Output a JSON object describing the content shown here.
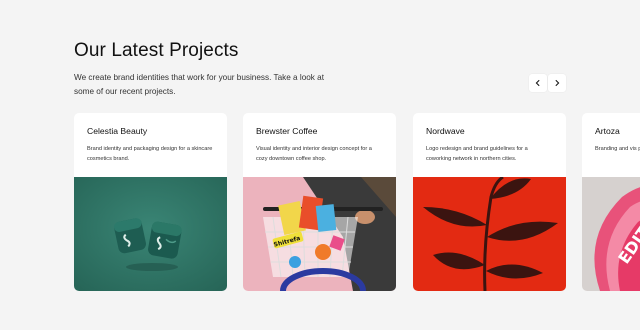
{
  "section": {
    "title": "Our Latest Projects",
    "subtitle": "We create brand identities that work for your business. Take a look at some of our recent projects."
  },
  "nav": {
    "prev_icon": "chevron-left-icon",
    "next_icon": "chevron-right-icon"
  },
  "projects": [
    {
      "name": "Celestia Beauty",
      "description": "Brand identity and packaging design for a skincare cosmetics brand.",
      "image": "skincare-jars-image",
      "image_bg": "#2f7466"
    },
    {
      "name": "Brewster Coffee",
      "description": "Visual identity and interior design concept for a cozy downtown coffee shop.",
      "image": "coffee-bike-basket-image",
      "image_bg": "#e9a8b4",
      "image_text": "Shitrefa"
    },
    {
      "name": "Nordwave",
      "description": "Logo redesign and brand guidelines for a coworking network in northern cities.",
      "image": "red-plant-silhouette-image",
      "image_bg": "#e32a12"
    },
    {
      "name": "Artoza",
      "description": "Branding and vis platform for crea",
      "image": "pink-3d-typography-image",
      "image_bg": "#d9d4d2",
      "image_text": "EDIT"
    }
  ]
}
